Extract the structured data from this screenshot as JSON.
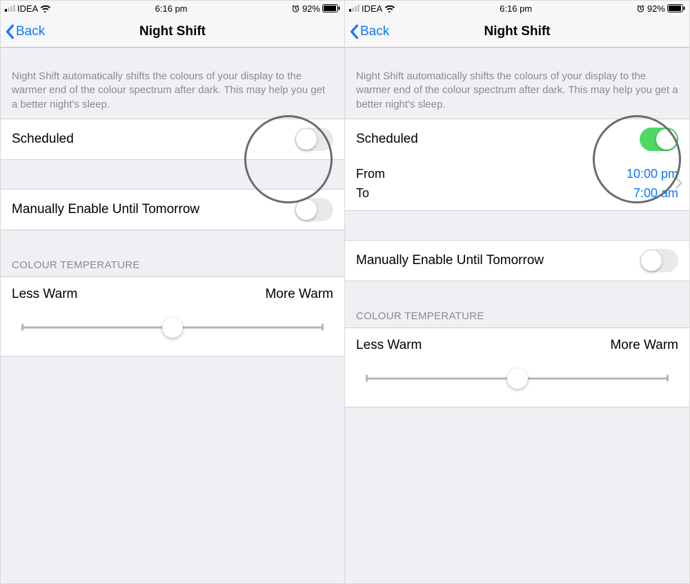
{
  "status": {
    "carrier": "IDEA",
    "time": "6:16 pm",
    "battery": "92%"
  },
  "nav": {
    "back": "Back",
    "title": "Night Shift"
  },
  "descr": "Night Shift automatically shifts the colours of your display to the warmer end of the colour spectrum after dark. This may help you get a better night's sleep.",
  "rows": {
    "scheduled": "Scheduled",
    "from": "From",
    "from_val": "10:00 pm",
    "to": "To",
    "to_val": "7:00 am",
    "manual": "Manually Enable Until Tomorrow"
  },
  "temp": {
    "header": "COLOUR TEMPERATURE",
    "less": "Less Warm",
    "more": "More Warm"
  }
}
